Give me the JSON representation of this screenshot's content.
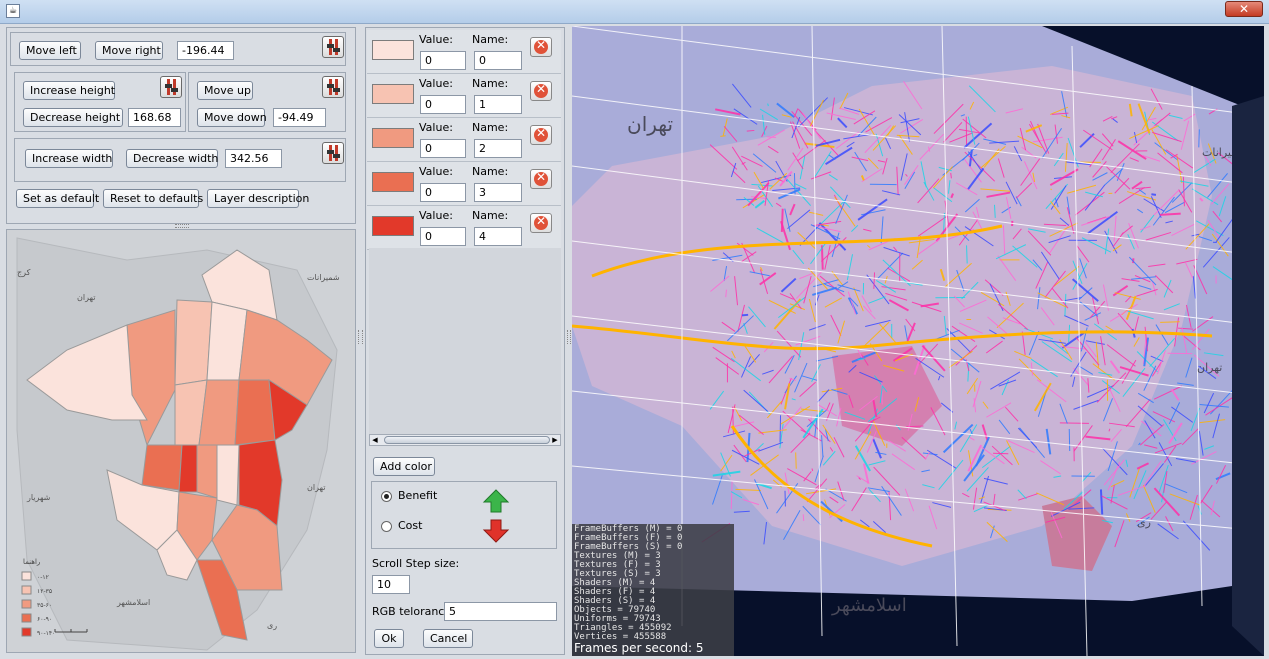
{
  "window": {
    "icon": "java-icon",
    "close": "✕"
  },
  "controls": {
    "move_left": "Move left",
    "move_right": "Move right",
    "horizontal_value": "-196.44",
    "increase_height": "Increase height",
    "decrease_height": "Decrease height",
    "height_value": "168.68",
    "move_up": "Move up",
    "move_down": "Move down",
    "vertical_value": "-94.49",
    "increase_width": "Increase width",
    "decrease_width": "Decrease width",
    "width_value": "342.56",
    "set_default": "Set as default",
    "reset_defaults": "Reset to defaults",
    "layer_description": "Layer description"
  },
  "colors": {
    "headers": {
      "value": "Value:",
      "name": "Name:"
    },
    "rows": [
      {
        "color": "#fbe3dc",
        "value": "0",
        "name": "0"
      },
      {
        "color": "#f7c3b2",
        "value": "0",
        "name": "1"
      },
      {
        "color": "#f09a80",
        "value": "0",
        "name": "2"
      },
      {
        "color": "#ea6f52",
        "value": "0",
        "name": "3"
      },
      {
        "color": "#e2392a",
        "value": "0",
        "name": "4"
      }
    ]
  },
  "mid": {
    "add_color": "Add color",
    "benefit": "Benefit",
    "cost": "Cost",
    "scroll_step_label": "Scroll Step size:",
    "scroll_step_value": "10",
    "rgb_label": "RGB telorance:",
    "rgb_value": "5",
    "ok": "Ok",
    "cancel": "Cancel"
  },
  "map": {
    "north_label": "شمیرانات",
    "west_label": "شهریار",
    "south_label": "اسلامشهر",
    "east_label": "تهران",
    "rey_label": "ری",
    "karaj_label": "کرج",
    "legend_title": "راهنما",
    "legend_items": [
      "۰-۱۲",
      "۱۲-۳۵",
      "۳۵-۶۰",
      "۶۰-۹۰",
      "۹۰-۱۴۰"
    ]
  },
  "view": {
    "tehran_label": "تهران",
    "shemiranat_label": "شمیرانات",
    "tehran_east_label": "تهران",
    "rey_label": "ری",
    "islamshahr_label": "اسلامشهر",
    "stats": [
      "FrameBuffers (M) = 0",
      "FrameBuffers (F) = 0",
      "FrameBuffers (S) = 0",
      "Textures (M) = 3",
      "Textures (F) = 3",
      "Textures (S) = 3",
      "Shaders (M) = 4",
      "Shaders (F) = 4",
      "Shaders (S) = 4",
      "Objects = 79740",
      "Uniforms = 79743",
      "Triangles = 455092",
      "Vertices = 455588"
    ],
    "fps": "Frames per second: 5"
  }
}
